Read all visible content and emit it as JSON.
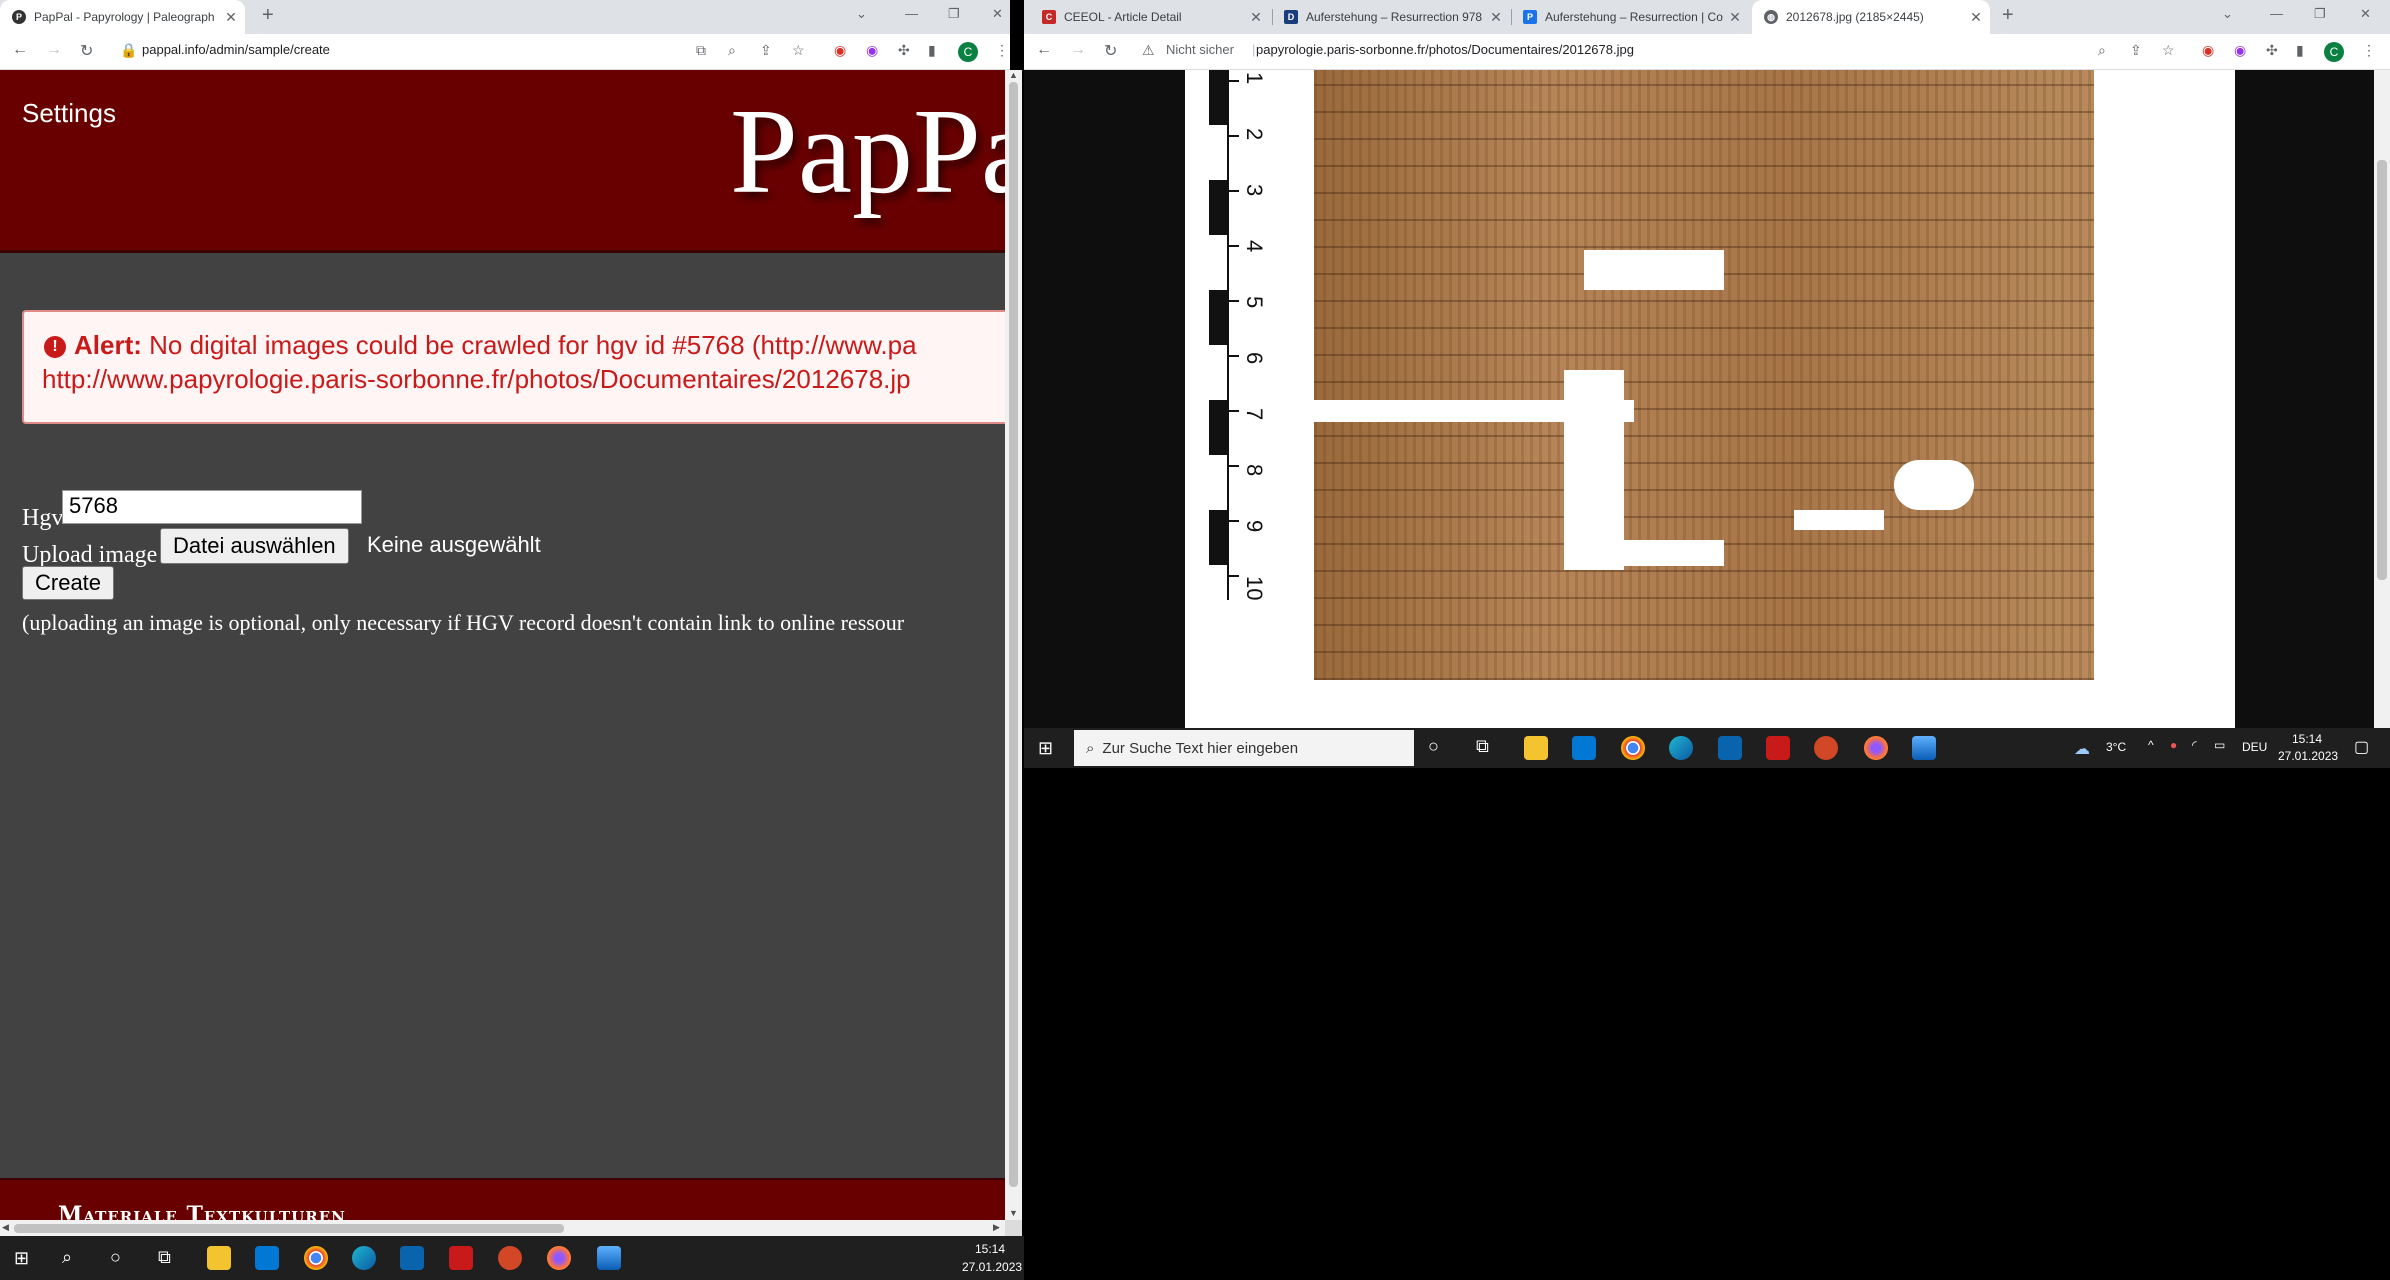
{
  "left_window": {
    "tabs": [
      {
        "title": "PapPal - Papyrology | Paleograph",
        "active": true
      }
    ],
    "url": "pappal.info/admin/sample/create"
  },
  "right_window": {
    "tabs": [
      {
        "title": "CEEOL - Article Detail",
        "active": false
      },
      {
        "title": "Auferstehung – Resurrection 978",
        "active": false
      },
      {
        "title": "Auferstehung – Resurrection | Co",
        "active": false
      },
      {
        "title": "2012678.jpg (2185×2445)",
        "active": true
      }
    ],
    "security_label": "Nicht sicher",
    "url": "papyrologie.paris-sorbonne.fr/photos/Documentaires/2012678.jpg"
  },
  "avatar_letter": "C",
  "page": {
    "settings_label": "Settings",
    "logo_text": "PapPal",
    "alert": {
      "heading": "Alert:",
      "line1": "No digital images could be crawled for hgv id #5768 (http://www.pa",
      "line2": "http://www.papyrologie.paris-sorbonne.fr/photos/Documentaires/2012678.jp"
    },
    "form": {
      "hgv_label": "Hgv",
      "hgv_value": "5768",
      "upload_label": "Upload image",
      "file_button": "Datei auswählen",
      "no_file": "Keine ausgewählt",
      "create_button": "Create",
      "note": "(uploading an image is optional, only necessary if HGV record doesn't contain link to online ressour"
    },
    "footer_text": "Materiale Textkulturen"
  },
  "ruler_numbers": [
    "1",
    "2",
    "3",
    "4",
    "5",
    "6",
    "7",
    "8",
    "9",
    "10"
  ],
  "taskbar_left": {
    "time": "15:14",
    "date": "27.01.2023"
  },
  "taskbar_right": {
    "search_placeholder": "Zur Suche Text hier eingeben",
    "weather": "3°C",
    "language": "DEU",
    "time": "15:14",
    "date": "27.01.2023"
  }
}
